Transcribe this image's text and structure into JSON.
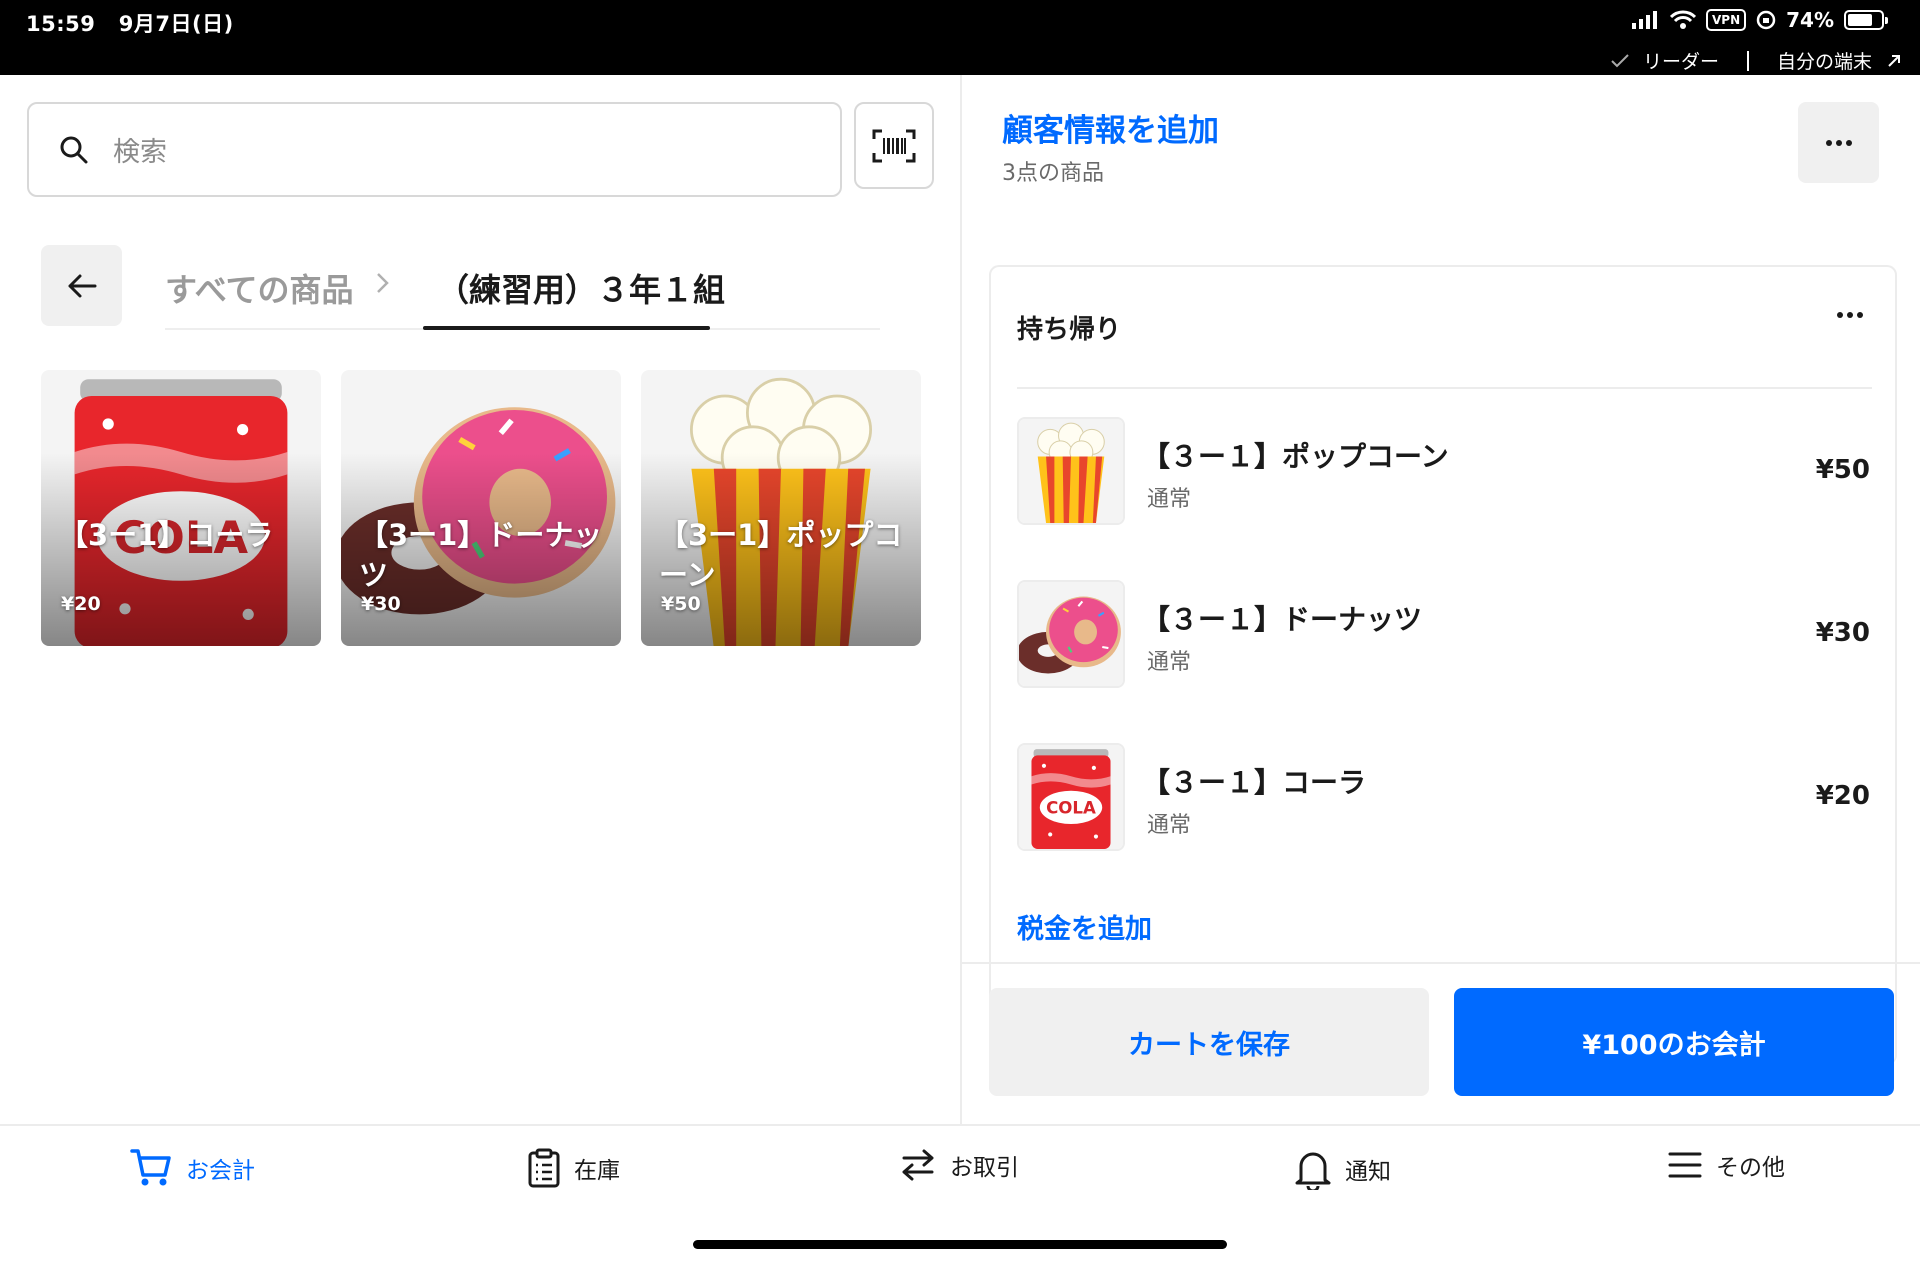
{
  "status_bar": {
    "time": "15:59",
    "date": "9月7日(日)",
    "vpn": "VPN",
    "battery": "74%",
    "battery_level": 0.74,
    "reader": "リーダー",
    "device": "自分の端末"
  },
  "search": {
    "placeholder": "検索"
  },
  "breadcrumb": {
    "all_items": "すべての商品",
    "current": "（練習用）３年１組"
  },
  "tiles": [
    {
      "name": "【3ー1】コーラ",
      "price": "¥20",
      "art": "cola"
    },
    {
      "name": "【3ー1】ドーナッツ",
      "price": "¥30",
      "art": "donut"
    },
    {
      "name": "【3ー1】ポップコーン",
      "price": "¥50",
      "art": "popcorn"
    }
  ],
  "cart": {
    "add_customer": "顧客情報を追加",
    "item_count": "3点の商品",
    "section_title": "持ち帰り",
    "lines": [
      {
        "name": "【３ー１】ポップコーン",
        "variant": "通常",
        "price": "¥50",
        "art": "popcorn"
      },
      {
        "name": "【３ー１】ドーナッツ",
        "variant": "通常",
        "price": "¥30",
        "art": "donut"
      },
      {
        "name": "【３ー１】コーラ",
        "variant": "通常",
        "price": "¥20",
        "art": "cola"
      }
    ],
    "add_tax": "税金を追加",
    "save_cart": "カートを保存",
    "checkout": "¥100のお会計"
  },
  "nav": {
    "checkout": "お会計",
    "inventory": "在庫",
    "transactions": "お取引",
    "notifications": "通知",
    "more": "その他"
  },
  "colors": {
    "accent": "#006aff",
    "status_bar": "#000000"
  }
}
